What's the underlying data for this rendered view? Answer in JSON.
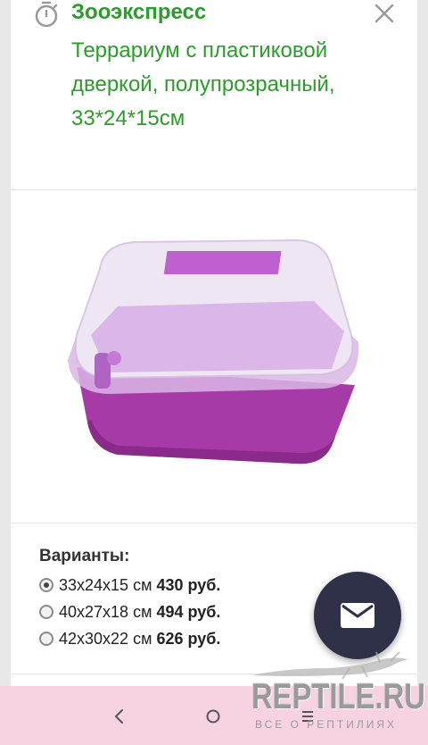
{
  "header": {
    "store_name": "Зооэкспресс",
    "product_title": "Террариум с пластиковой дверкой, полупрозрачный, 33*24*15см"
  },
  "variants": {
    "label": "Варианты:",
    "items": [
      {
        "size": "33x24x15 см",
        "price": "430 руб.",
        "selected": true
      },
      {
        "size": "40x27x18 см",
        "price": "494 руб.",
        "selected": false
      },
      {
        "size": "42x30x22 см",
        "price": "626 руб.",
        "selected": false
      }
    ]
  },
  "watermark": {
    "logo": "REPTILE.RU",
    "tagline": "ВСЕ О РЕПТИЛИЯХ"
  },
  "colors": {
    "accent_green": "#2a9d2a",
    "fab_bg": "#2f3148",
    "navbar_bg": "#f7d3e1"
  }
}
